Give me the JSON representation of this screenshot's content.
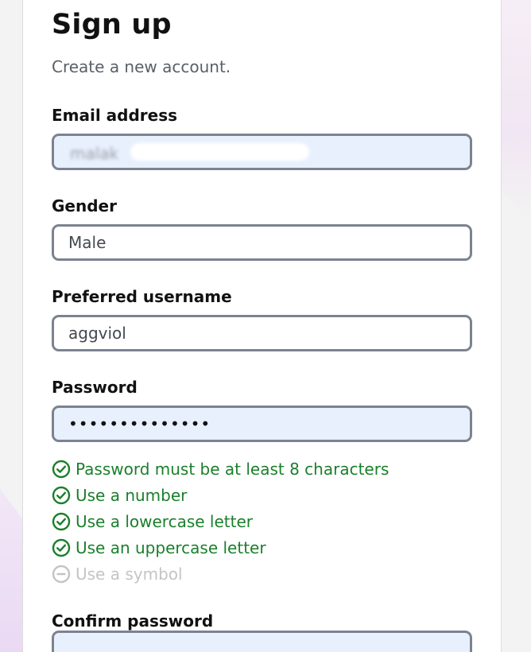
{
  "colors": {
    "success": "#1a7f2b",
    "pending": "#c4c4c4",
    "input_border": "#7b8390",
    "autofill_bg": "#e8f0fe"
  },
  "form": {
    "title": "Sign up",
    "subtitle": "Create a new account.",
    "email": {
      "label": "Email address",
      "value": "",
      "visible_fragment": "malak",
      "note": "value redacted/blurred in screenshot"
    },
    "gender": {
      "label": "Gender",
      "value": "Male"
    },
    "username": {
      "label": "Preferred username",
      "value": "aggviol"
    },
    "password": {
      "label": "Password",
      "value": "••••••••••••••"
    },
    "password_rules": [
      {
        "text": "Password must be at least 8 characters",
        "status": "met",
        "icon": "check-circle-icon"
      },
      {
        "text": "Use a number",
        "status": "met",
        "icon": "check-circle-icon"
      },
      {
        "text": "Use a lowercase letter",
        "status": "met",
        "icon": "check-circle-icon"
      },
      {
        "text": "Use an uppercase letter",
        "status": "met",
        "icon": "check-circle-icon"
      },
      {
        "text": "Use a symbol",
        "status": "unmet",
        "icon": "minus-circle-icon"
      }
    ],
    "confirm_password": {
      "label": "Confirm password",
      "value": ""
    }
  }
}
